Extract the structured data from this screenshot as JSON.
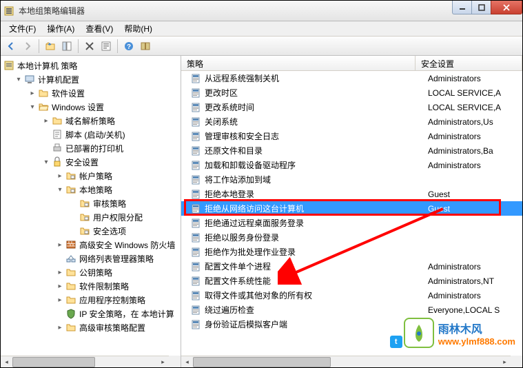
{
  "window": {
    "title": "本地组策略编辑器"
  },
  "menu": {
    "file": "文件(F)",
    "action": "操作(A)",
    "view": "查看(V)",
    "help": "帮助(H)"
  },
  "tree": {
    "root": "本地计算机 策略",
    "computer_config": "计算机配置",
    "software_settings": "软件设置",
    "windows_settings": "Windows 设置",
    "name_resolution": "域名解析策略",
    "scripts": "脚本 (启动/关机)",
    "printers": "已部署的打印机",
    "security_settings": "安全设置",
    "account_policies": "帐户策略",
    "local_policies": "本地策略",
    "audit_policy": "审核策略",
    "user_rights": "用户权限分配",
    "security_options": "安全选项",
    "advanced_firewall": "高级安全 Windows 防火墙",
    "network_list": "网络列表管理器策略",
    "public_key": "公钥策略",
    "software_restriction": "软件限制策略",
    "app_control": "应用程序控制策略",
    "ip_security": "IP 安全策略，在 本地计算",
    "advanced_audit": "高级审核策略配置"
  },
  "columns": {
    "policy": "策略",
    "security_setting": "安全设置"
  },
  "policies": [
    {
      "name": "从远程系统强制关机",
      "setting": "Administrators"
    },
    {
      "name": "更改时区",
      "setting": "LOCAL SERVICE,A"
    },
    {
      "name": "更改系统时间",
      "setting": "LOCAL SERVICE,A"
    },
    {
      "name": "关闭系统",
      "setting": "Administrators,Us"
    },
    {
      "name": "管理审核和安全日志",
      "setting": "Administrators"
    },
    {
      "name": "还原文件和目录",
      "setting": "Administrators,Ba"
    },
    {
      "name": "加载和卸载设备驱动程序",
      "setting": "Administrators"
    },
    {
      "name": "将工作站添加到域",
      "setting": ""
    },
    {
      "name": "拒绝本地登录",
      "setting": "Guest"
    },
    {
      "name": "拒绝从网络访问这台计算机",
      "setting": "Guest",
      "selected": true
    },
    {
      "name": "拒绝通过远程桌面服务登录",
      "setting": ""
    },
    {
      "name": "拒绝以服务身份登录",
      "setting": ""
    },
    {
      "name": "拒绝作为批处理作业登录",
      "setting": ""
    },
    {
      "name": "配置文件单个进程",
      "setting": "Administrators"
    },
    {
      "name": "配置文件系统性能",
      "setting": "Administrators,NT"
    },
    {
      "name": "取得文件或其他对象的所有权",
      "setting": "Administrators"
    },
    {
      "name": "绕过遍历检查",
      "setting": "Everyone,LOCAL S"
    },
    {
      "name": "身份验证后模拟客户端",
      "setting": ""
    }
  ],
  "watermark": {
    "cn": "雨林木风",
    "en": "www.ylmf888.com"
  }
}
